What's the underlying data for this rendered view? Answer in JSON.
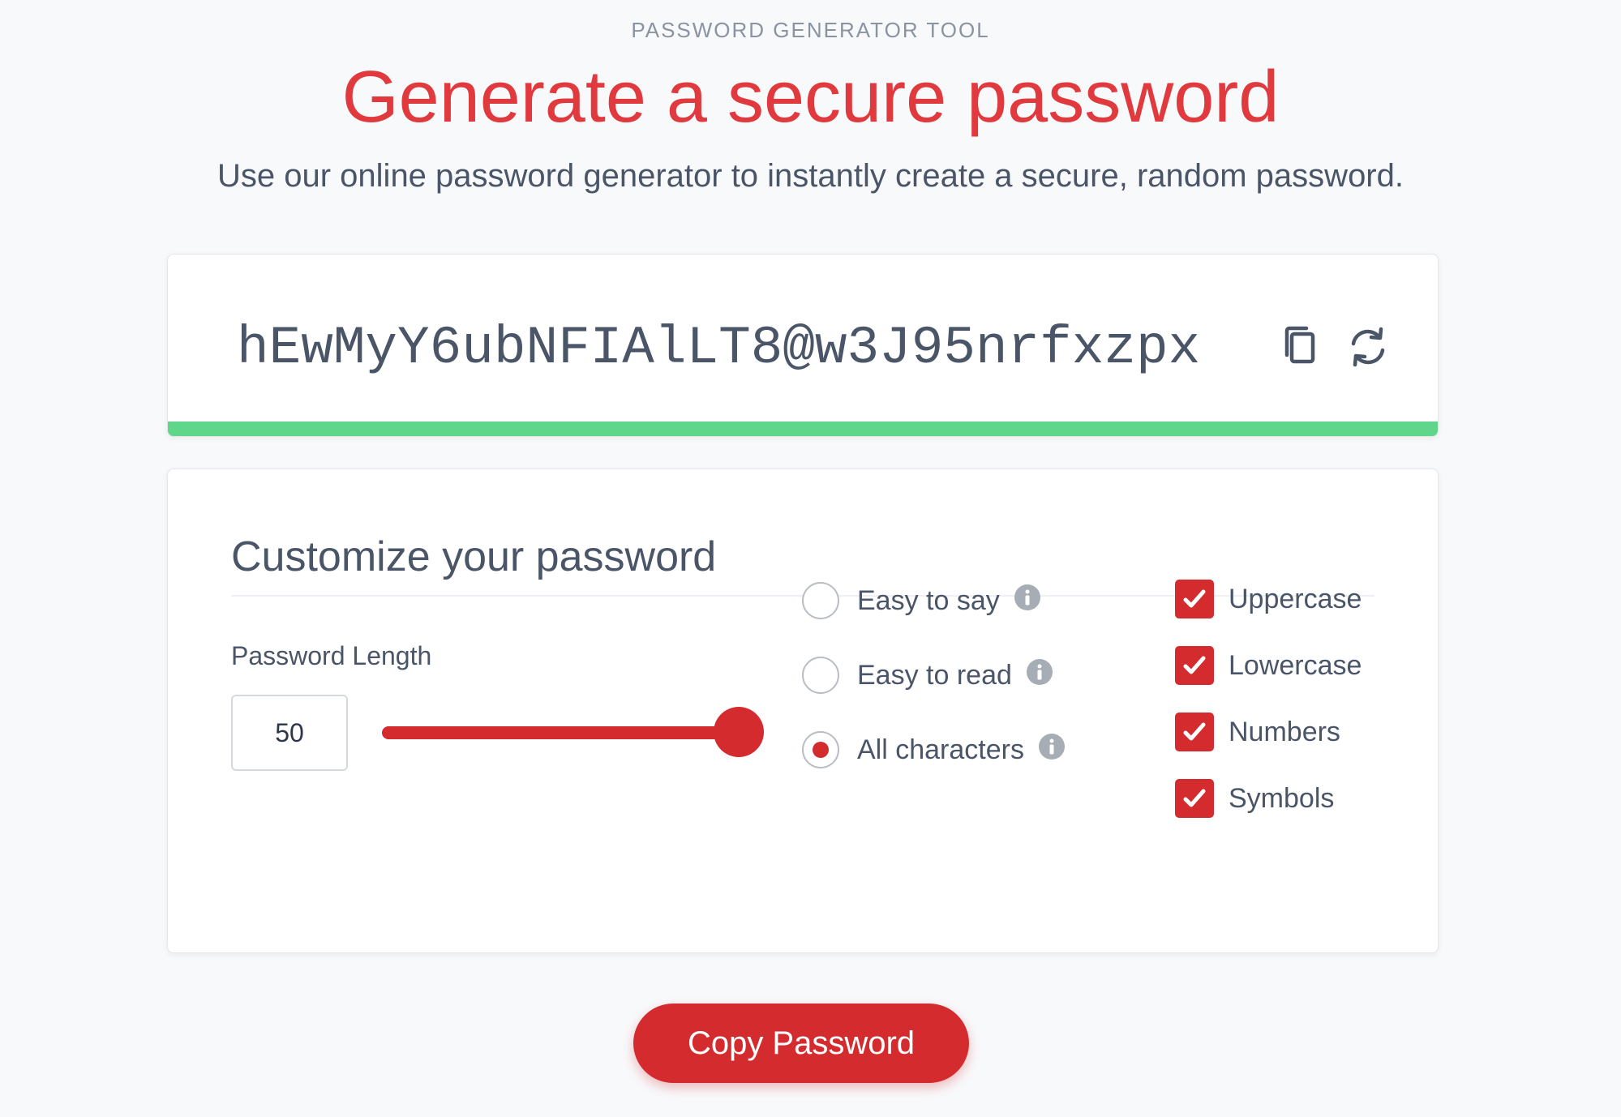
{
  "header": {
    "eyebrow": "PASSWORD GENERATOR TOOL",
    "title": "Generate a secure password",
    "subtitle": "Use our online password generator to instantly create a secure, random password."
  },
  "generator": {
    "password": "hEwMyY6ubNFIAlLT8@w3J95nrfxzpx",
    "strength_color": "#5fd68a",
    "strength_fraction": 1.0,
    "copy_icon": "copy-icon",
    "refresh_icon": "refresh-icon"
  },
  "customize": {
    "heading": "Customize your password",
    "length_label": "Password Length",
    "length_value": "50",
    "slider": {
      "min": 1,
      "max": 50,
      "value": 50
    },
    "char_modes": [
      {
        "label": "Easy to say",
        "checked": false
      },
      {
        "label": "Easy to read",
        "checked": false
      },
      {
        "label": "All characters",
        "checked": true
      }
    ],
    "char_types": [
      {
        "label": "Uppercase",
        "checked": true
      },
      {
        "label": "Lowercase",
        "checked": true
      },
      {
        "label": "Numbers",
        "checked": true
      },
      {
        "label": "Symbols",
        "checked": true
      }
    ]
  },
  "actions": {
    "copy_button": "Copy Password"
  },
  "colors": {
    "brand_red": "#d42b2f",
    "title_red": "#e03a3e",
    "strength_green": "#5fd68a"
  }
}
